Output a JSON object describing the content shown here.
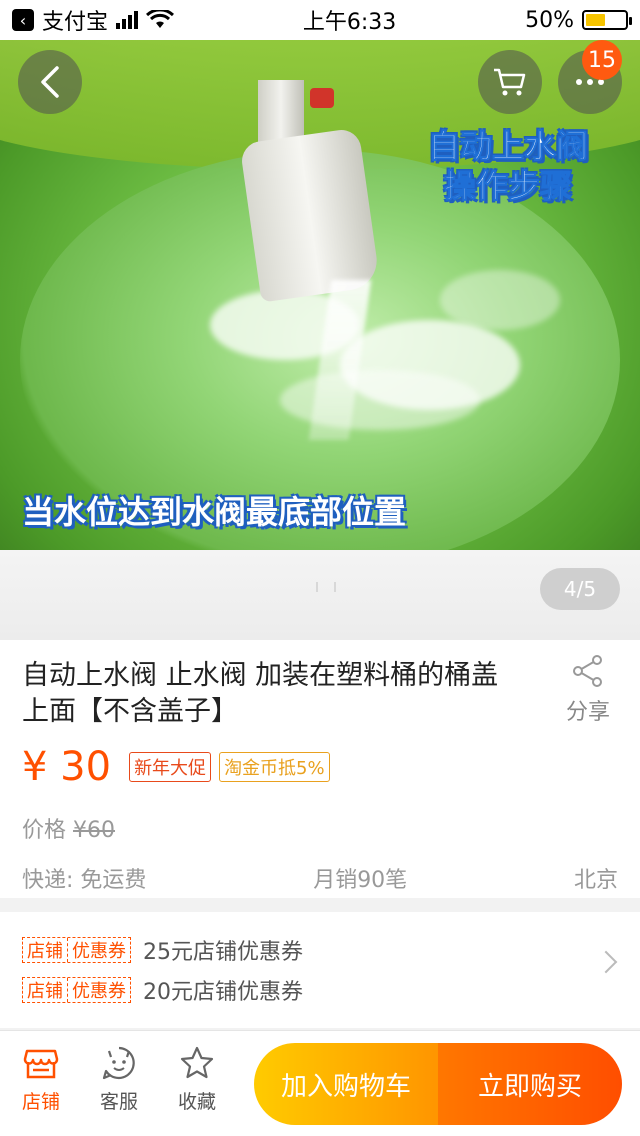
{
  "status_bar": {
    "app": "支付宝",
    "time": "上午6:33",
    "battery": "50%",
    "battery_level": 0.5
  },
  "header": {
    "badge_count": "15",
    "icons": [
      "back-arrow-icon",
      "cart-icon",
      "more-icon"
    ]
  },
  "hero": {
    "caption_top_line1": "自动上水阀",
    "caption_top_line2": "操作步骤",
    "caption_bottom": "当水位达到水阀最底部位置"
  },
  "gallery": {
    "page_indicator": "4/5"
  },
  "product": {
    "title": "自动上水阀  止水阀 加装在塑料桶的桶盖上面【不含盖子】",
    "share_label": "分享",
    "price": "¥ 30",
    "tags": [
      "新年大促",
      "淘金币抵5%"
    ],
    "orig_price_label": "价格",
    "orig_price": "¥60",
    "shipping": "快递: 免运费",
    "monthly_sales": "月销90笔",
    "location": "北京"
  },
  "coupons": [
    {
      "tag_left": "店铺",
      "tag_right": "优惠券",
      "text": "25元店铺优惠券"
    },
    {
      "tag_left": "店铺",
      "tag_right": "优惠券",
      "text": "20元店铺优惠券"
    }
  ],
  "bottom_bar": {
    "store": "店铺",
    "service": "客服",
    "favorite": "收藏",
    "add_to_cart": "加入购物车",
    "buy_now": "立即购买"
  },
  "colors": {
    "accent": "#ff5000",
    "cart_button": "#ffa400",
    "buy_button": "#ff5a00",
    "coin_tag": "#e9a11f"
  }
}
